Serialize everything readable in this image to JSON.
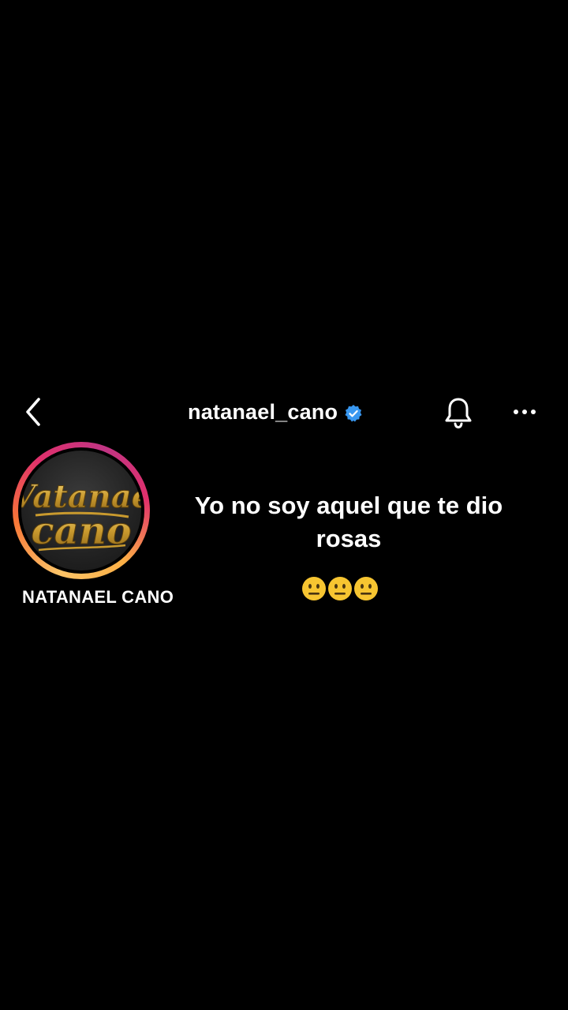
{
  "header": {
    "username": "natanael_cano",
    "verified": true,
    "icons": {
      "back": "chevron-left-icon",
      "verified": "verified-badge-icon",
      "notifications": "bell-icon",
      "more": "more-horizontal-icon"
    }
  },
  "profile": {
    "display_name": "NATANAEL CANO",
    "avatar_text": "Vatanae cano"
  },
  "post": {
    "message": "Yo no soy aquel que te dio rosas",
    "emoji_count": 3,
    "emoji_name": "neutral-face-icon"
  },
  "colors": {
    "background": "#000000",
    "text": "#ffffff",
    "verified_blue": "#3897f0",
    "emoji_yellow": "#f7c531",
    "logo_gold": "#d4a93a"
  }
}
